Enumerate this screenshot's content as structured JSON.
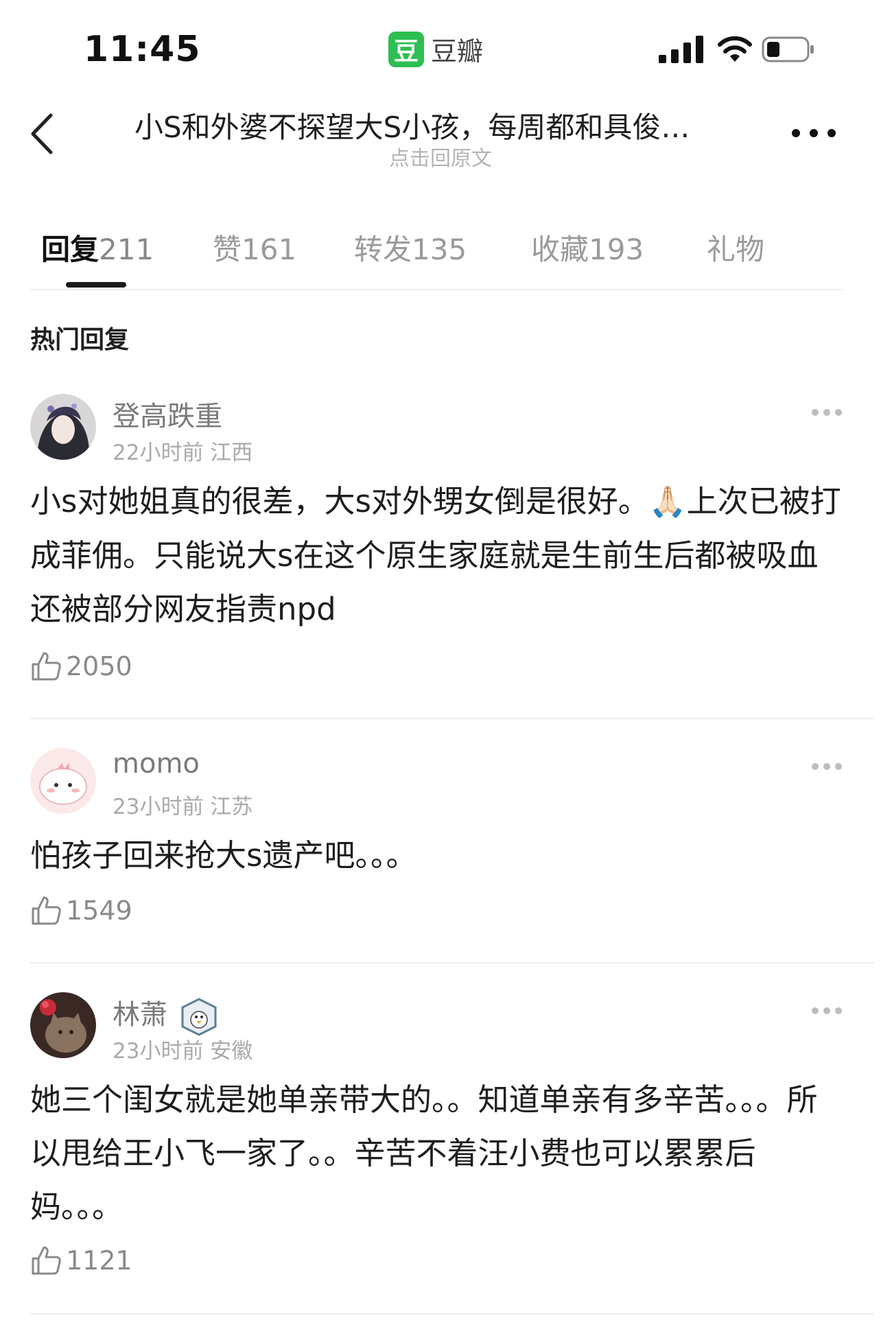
{
  "status_bar": {
    "time": "11:45",
    "app_logo": "豆",
    "app_name": "豆瓣"
  },
  "nav": {
    "title": "小S和外婆不探望大S小孩，每周都和具俊…",
    "subtitle": "点击回原文"
  },
  "tabs": [
    {
      "label": "回复",
      "count": "211"
    },
    {
      "label": "赞",
      "count": "161"
    },
    {
      "label": "转发",
      "count": "135"
    },
    {
      "label": "收藏",
      "count": "193"
    },
    {
      "label": "礼物",
      "count": ""
    }
  ],
  "section_title": "热门回复",
  "comments": [
    {
      "username": "登高跌重",
      "meta": "22小时前 江西",
      "text_before_emoji": "小s对她姐真的很差，大s对外甥女倒是很好。",
      "emoji": "🙏🏻",
      "text_after_emoji": "上次已被打成菲佣。只能说大s在这个原生家庭就是生前生后都被吸血还被部分网友指责npd",
      "likes": "2050"
    },
    {
      "username": "momo",
      "meta": "23小时前 江苏",
      "text": "怕孩子回来抢大s遗产吧。。。",
      "likes": "1549"
    },
    {
      "username": "林萧",
      "meta": "23小时前 安徽",
      "text": "她三个闺女就是她单亲带大的。。知道单亲有多辛苦。。。所以甩给王小飞一家了。。辛苦不着汪小费也可以累累后妈。。。",
      "likes": "1121"
    }
  ],
  "colors": {
    "brand_green": "#2dbf52",
    "active_tab": "#111111",
    "muted_text": "#9a9a9a"
  }
}
